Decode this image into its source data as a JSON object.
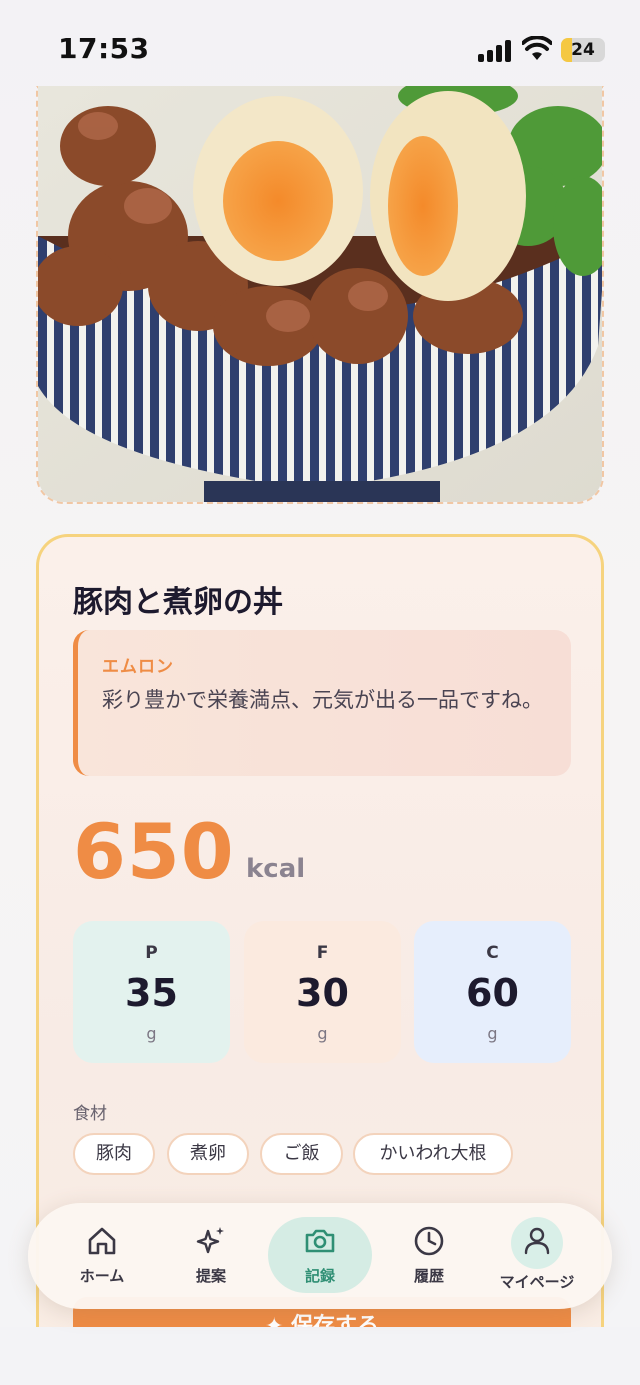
{
  "status_bar": {
    "time": "17:53",
    "battery": "24",
    "battery_level": 0.24,
    "icons": [
      "signal-icon",
      "wifi-icon",
      "battery-icon"
    ]
  },
  "photo": {
    "description_icon": "food-photo"
  },
  "meal": {
    "title": "豚肉と煮卵の丼",
    "comment_author": "エムロン",
    "comment_text": "彩り豊かで栄養満点、元気が出る一品ですね。",
    "calories": "650",
    "calories_unit": "kcal"
  },
  "macros": [
    {
      "key": "P",
      "value": "35",
      "unit": "g",
      "color": "#e3f2ee"
    },
    {
      "key": "F",
      "value": "30",
      "unit": "g",
      "color": "#fbeadf"
    },
    {
      "key": "C",
      "value": "60",
      "unit": "g",
      "color": "#e6eefc"
    }
  ],
  "ingredients": {
    "label": "食材",
    "items": [
      "豚肉",
      "煮卵",
      "ご飯",
      "かいわれ大根"
    ]
  },
  "save_button": {
    "label": "保存する"
  },
  "nav": {
    "items": [
      {
        "label": "ホーム",
        "icon": "home-icon"
      },
      {
        "label": "提案",
        "icon": "sparkle-icon"
      },
      {
        "label": "記録",
        "icon": "camera-icon",
        "active": true
      },
      {
        "label": "履歴",
        "icon": "clock-icon"
      },
      {
        "label": "マイページ",
        "icon": "user-icon"
      }
    ]
  },
  "colors": {
    "accent": "#ef8c45",
    "active_nav": "#2f8f74",
    "text_dark": "#1d1a2e",
    "card_border": "#f6d37e"
  }
}
